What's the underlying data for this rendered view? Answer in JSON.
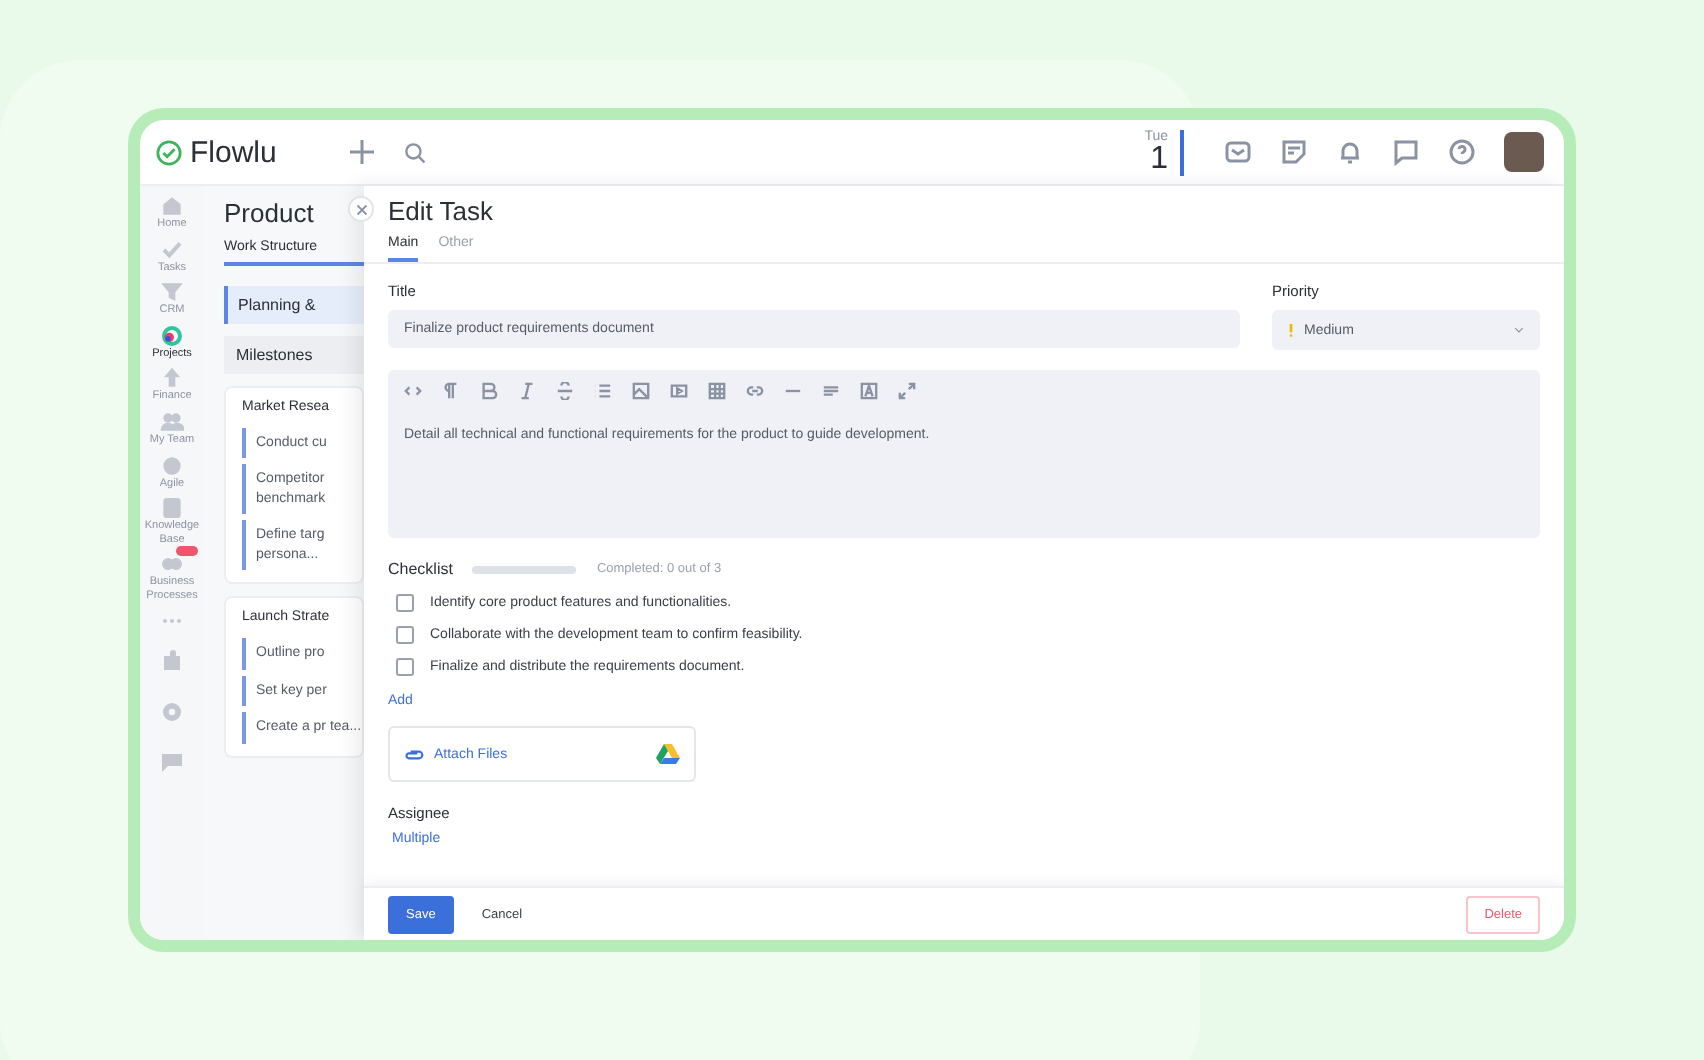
{
  "topbar": {
    "logo": "Flowlu",
    "day": "Tue",
    "date": "1"
  },
  "sidebar": {
    "items": [
      {
        "label": "Home",
        "selected": false,
        "badge": false
      },
      {
        "label": "Tasks",
        "selected": false,
        "badge": false
      },
      {
        "label": "CRM",
        "selected": false,
        "badge": false
      },
      {
        "label": "Projects",
        "selected": true,
        "badge": false
      },
      {
        "label": "Finance",
        "selected": false,
        "badge": false
      },
      {
        "label": "My Team",
        "selected": false,
        "badge": false
      },
      {
        "label": "Agile",
        "selected": false,
        "badge": false
      },
      {
        "label": "Knowledge Base",
        "selected": false,
        "badge": false
      },
      {
        "label": "Business Processes",
        "selected": false,
        "badge": true
      }
    ]
  },
  "project": {
    "title": "Product",
    "tab": "Work Structure",
    "stage": "Planning &",
    "milestones": "Milestones",
    "groups": [
      {
        "title": "Market Resea",
        "tasks": [
          "Conduct cu",
          "Competitor benchmark",
          "Define targ persona..."
        ]
      },
      {
        "title": "Launch Strate",
        "tasks": [
          "Outline pro",
          "Set key per",
          "Create a pr tea..."
        ]
      }
    ]
  },
  "drawer": {
    "title": "Edit Task",
    "tabs": [
      {
        "label": "Main",
        "selected": true
      },
      {
        "label": "Other",
        "selected": false
      }
    ],
    "title_field": {
      "label": "Title",
      "value": "Finalize product requirements document"
    },
    "priority": {
      "label": "Priority",
      "value": "Medium"
    },
    "description": "Detail all technical and functional requirements for the product to guide development.",
    "checklist": {
      "label": "Checklist",
      "level": 0,
      "summary": "Completed: 0 out of 3",
      "items": [
        {
          "text": "Identify core product features and functionalities.",
          "checked": false
        },
        {
          "text": "Collaborate with the development team to confirm feasibility.",
          "checked": false
        },
        {
          "text": "Finalize and distribute the requirements document.",
          "checked": false
        }
      ],
      "add": "Add"
    },
    "attach": "Attach Files",
    "assignee": {
      "label": "Assignee",
      "value": "Multiple"
    },
    "buttons": {
      "save": "Save",
      "cancel": "Cancel",
      "delete": "Delete"
    }
  }
}
